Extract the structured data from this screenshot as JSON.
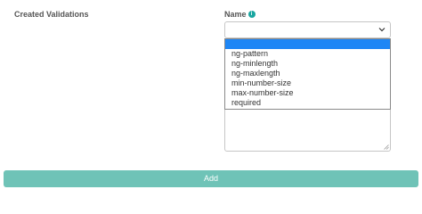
{
  "section": {
    "title": "Created Validations"
  },
  "field": {
    "label": "Name",
    "info_icon": "info-icon"
  },
  "select": {
    "selected_value": "",
    "options": [
      "",
      "ng-pattern",
      "ng-minlength",
      "ng-maxlength",
      "min-number-size",
      "max-number-size",
      "required"
    ],
    "highlight_color": "#1e86f5"
  },
  "add_button": {
    "label": "Add",
    "color": "#6fc3b7"
  },
  "colors": {
    "accent": "#1aa6a0"
  }
}
